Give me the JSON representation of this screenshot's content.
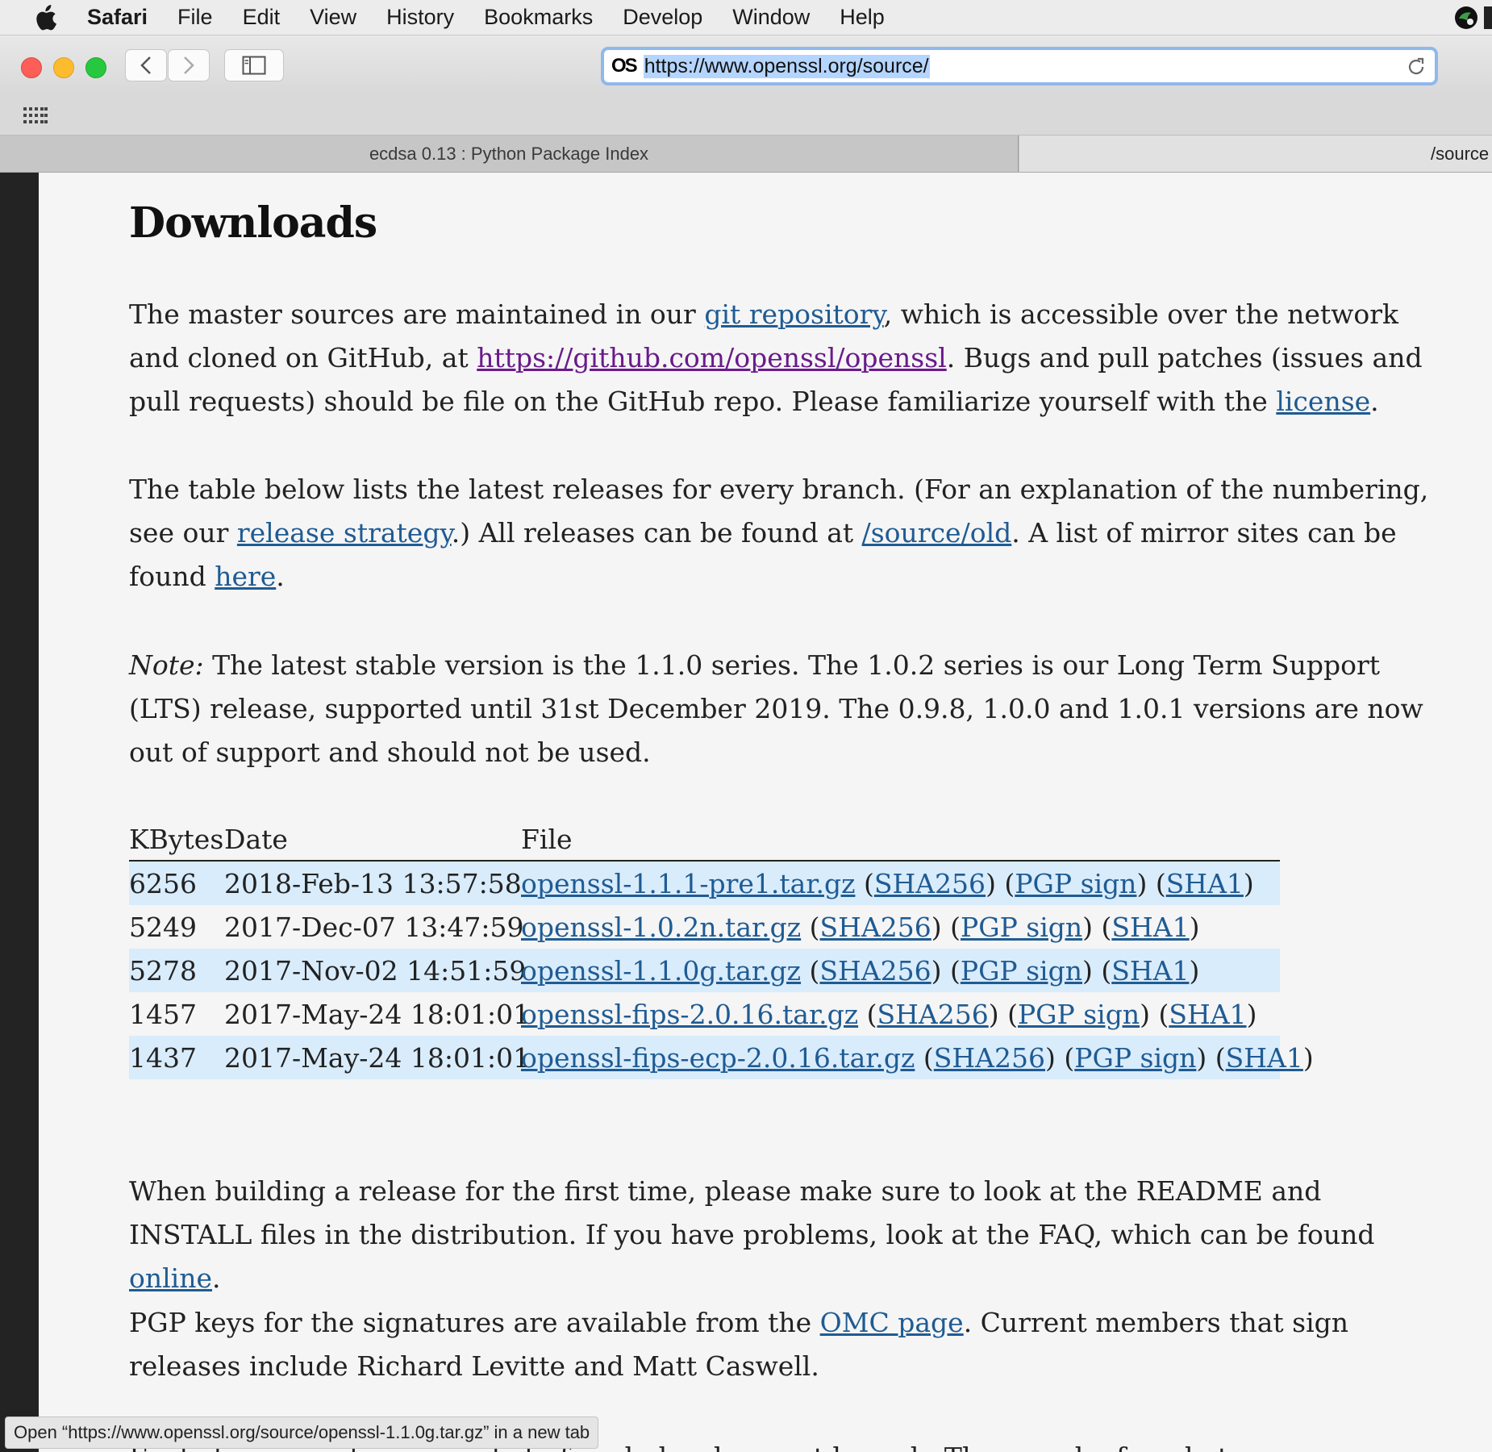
{
  "menubar": {
    "app": "Safari",
    "items": [
      "File",
      "Edit",
      "View",
      "History",
      "Bookmarks",
      "Develop",
      "Window",
      "Help"
    ]
  },
  "toolbar": {
    "site_icon": "OS",
    "url": "https://www.openssl.org/source/"
  },
  "tabs": [
    {
      "label": "ecdsa 0.13 : Python Package Index",
      "active": false
    },
    {
      "label": "/source",
      "active": true
    }
  ],
  "page": {
    "title": "Downloads",
    "p1": {
      "t1": "The master sources are maintained in our ",
      "link1": "git repository",
      "t2": ", which is accessible over the network and cloned on GitHub, at ",
      "link2": "https://github.com/openssl/openssl",
      "t3": ". Bugs and pull patches (issues and pull requests) should be file on the GitHub repo. Please familiarize yourself with the ",
      "link3": "license",
      "t4": "."
    },
    "p2": {
      "t1": "The table below lists the latest releases for every branch. (For an explanation of the numbering, see our ",
      "link1": "release strategy",
      "t2": ".) All releases can be found at ",
      "link2": "/source/old",
      "t3": ". A list of mirror sites can be found ",
      "link3": "here",
      "t4": "."
    },
    "p3": {
      "note": "Note:",
      "text": " The latest stable version is the 1.1.0 series. The 1.0.2 series is our Long Term Support (LTS) release, supported until 31st December 2019. The 0.9.8, 1.0.0 and 1.0.1 versions are now out of support and should not be used."
    },
    "table": {
      "headers": [
        "KBytes",
        "Date",
        "File"
      ],
      "rows": [
        {
          "kbytes": "6256",
          "date": "2018-Feb-13 13:57:58",
          "file": "openssl-1.1.1-pre1.tar.gz",
          "sha256": "SHA256",
          "pgp": "PGP sign",
          "sha1": "SHA1"
        },
        {
          "kbytes": "5249",
          "date": "2017-Dec-07 13:47:59",
          "file": "openssl-1.0.2n.tar.gz",
          "sha256": "SHA256",
          "pgp": "PGP sign",
          "sha1": "SHA1"
        },
        {
          "kbytes": "5278",
          "date": "2017-Nov-02 14:51:59",
          "file": "openssl-1.1.0g.tar.gz",
          "sha256": "SHA256",
          "pgp": "PGP sign",
          "sha1": "SHA1"
        },
        {
          "kbytes": "1457",
          "date": "2017-May-24 18:01:01",
          "file": "openssl-fips-2.0.16.tar.gz",
          "sha256": "SHA256",
          "pgp": "PGP sign",
          "sha1": "SHA1"
        },
        {
          "kbytes": "1437",
          "date": "2017-May-24 18:01:01",
          "file": "openssl-fips-ecp-2.0.16.tar.gz",
          "sha256": "SHA256",
          "pgp": "PGP sign",
          "sha1": "SHA1"
        }
      ]
    },
    "p4": {
      "t1": "When building a release for the first time, please make sure to look at the README and INSTALL files in the distribution. If you have problems, look at the FAQ, which can be found ",
      "link1": "online",
      "t2": "."
    },
    "p5": {
      "t1": "PGP keys for the signatures are available from the ",
      "link1": "OMC page",
      "t2": ". Current members that sign releases include Richard Levitte and Matt Caswell."
    },
    "p6": {
      "t1": "Each day we make a snapshot of each development branch. They can be found at"
    }
  },
  "status_bar": "Open “https://www.openssl.org/source/openssl-1.1.0g.tar.gz” in a new tab",
  "colors": {
    "link": "#1f5b93",
    "visited_link": "#6a1a8a",
    "row_highlight": "#d9ecfb",
    "url_selection": "#b4d5fe"
  }
}
